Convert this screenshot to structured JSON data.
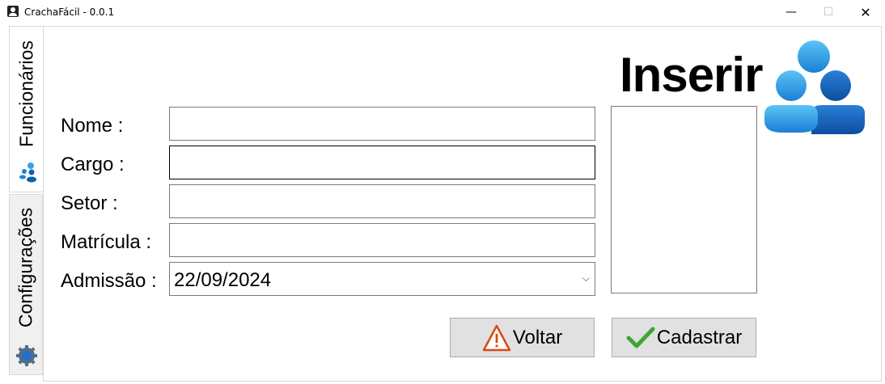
{
  "window": {
    "title": "CrachaFácil - 0.0.1",
    "controls": {
      "minimize": "—",
      "maximize": "☐",
      "close": "✕"
    }
  },
  "tabs": [
    {
      "label": "Funcionários",
      "icon": "users-icon",
      "active": true
    },
    {
      "label": "Configurações",
      "icon": "gear-icon",
      "active": false
    }
  ],
  "form": {
    "heading": "Inserir",
    "heading_icon": "users-group-icon",
    "fields": {
      "nome": {
        "label": "Nome :",
        "value": ""
      },
      "cargo": {
        "label": "Cargo :",
        "value": ""
      },
      "setor": {
        "label": "Setor :",
        "value": ""
      },
      "matricula": {
        "label": "Matrícula :",
        "value": ""
      },
      "admissao": {
        "label": "Admissão :",
        "value": "22/09/2024"
      }
    }
  },
  "buttons": {
    "voltar": {
      "label": "Voltar",
      "icon": "warning-icon"
    },
    "cadastrar": {
      "label": "Cadastrar",
      "icon": "checkmark-icon"
    }
  },
  "colors": {
    "accent_blue": "#1e88d8",
    "warning_orange": "#d9480f",
    "check_green": "#3fa535"
  }
}
